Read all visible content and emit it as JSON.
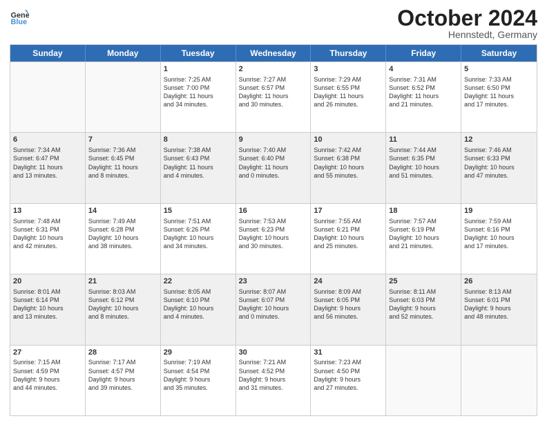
{
  "header": {
    "logo_line1": "General",
    "logo_line2": "Blue",
    "month": "October 2024",
    "location": "Hennstedt, Germany"
  },
  "weekdays": [
    "Sunday",
    "Monday",
    "Tuesday",
    "Wednesday",
    "Thursday",
    "Friday",
    "Saturday"
  ],
  "rows": [
    [
      {
        "day": "",
        "empty": true
      },
      {
        "day": "",
        "empty": true
      },
      {
        "day": "1",
        "lines": [
          "Sunrise: 7:25 AM",
          "Sunset: 7:00 PM",
          "Daylight: 11 hours",
          "and 34 minutes."
        ]
      },
      {
        "day": "2",
        "lines": [
          "Sunrise: 7:27 AM",
          "Sunset: 6:57 PM",
          "Daylight: 11 hours",
          "and 30 minutes."
        ]
      },
      {
        "day": "3",
        "lines": [
          "Sunrise: 7:29 AM",
          "Sunset: 6:55 PM",
          "Daylight: 11 hours",
          "and 26 minutes."
        ]
      },
      {
        "day": "4",
        "lines": [
          "Sunrise: 7:31 AM",
          "Sunset: 6:52 PM",
          "Daylight: 11 hours",
          "and 21 minutes."
        ]
      },
      {
        "day": "5",
        "lines": [
          "Sunrise: 7:33 AM",
          "Sunset: 6:50 PM",
          "Daylight: 11 hours",
          "and 17 minutes."
        ]
      }
    ],
    [
      {
        "day": "6",
        "lines": [
          "Sunrise: 7:34 AM",
          "Sunset: 6:47 PM",
          "Daylight: 11 hours",
          "and 13 minutes."
        ]
      },
      {
        "day": "7",
        "lines": [
          "Sunrise: 7:36 AM",
          "Sunset: 6:45 PM",
          "Daylight: 11 hours",
          "and 8 minutes."
        ]
      },
      {
        "day": "8",
        "lines": [
          "Sunrise: 7:38 AM",
          "Sunset: 6:43 PM",
          "Daylight: 11 hours",
          "and 4 minutes."
        ]
      },
      {
        "day": "9",
        "lines": [
          "Sunrise: 7:40 AM",
          "Sunset: 6:40 PM",
          "Daylight: 11 hours",
          "and 0 minutes."
        ]
      },
      {
        "day": "10",
        "lines": [
          "Sunrise: 7:42 AM",
          "Sunset: 6:38 PM",
          "Daylight: 10 hours",
          "and 55 minutes."
        ]
      },
      {
        "day": "11",
        "lines": [
          "Sunrise: 7:44 AM",
          "Sunset: 6:35 PM",
          "Daylight: 10 hours",
          "and 51 minutes."
        ]
      },
      {
        "day": "12",
        "lines": [
          "Sunrise: 7:46 AM",
          "Sunset: 6:33 PM",
          "Daylight: 10 hours",
          "and 47 minutes."
        ]
      }
    ],
    [
      {
        "day": "13",
        "lines": [
          "Sunrise: 7:48 AM",
          "Sunset: 6:31 PM",
          "Daylight: 10 hours",
          "and 42 minutes."
        ]
      },
      {
        "day": "14",
        "lines": [
          "Sunrise: 7:49 AM",
          "Sunset: 6:28 PM",
          "Daylight: 10 hours",
          "and 38 minutes."
        ]
      },
      {
        "day": "15",
        "lines": [
          "Sunrise: 7:51 AM",
          "Sunset: 6:26 PM",
          "Daylight: 10 hours",
          "and 34 minutes."
        ]
      },
      {
        "day": "16",
        "lines": [
          "Sunrise: 7:53 AM",
          "Sunset: 6:23 PM",
          "Daylight: 10 hours",
          "and 30 minutes."
        ]
      },
      {
        "day": "17",
        "lines": [
          "Sunrise: 7:55 AM",
          "Sunset: 6:21 PM",
          "Daylight: 10 hours",
          "and 25 minutes."
        ]
      },
      {
        "day": "18",
        "lines": [
          "Sunrise: 7:57 AM",
          "Sunset: 6:19 PM",
          "Daylight: 10 hours",
          "and 21 minutes."
        ]
      },
      {
        "day": "19",
        "lines": [
          "Sunrise: 7:59 AM",
          "Sunset: 6:16 PM",
          "Daylight: 10 hours",
          "and 17 minutes."
        ]
      }
    ],
    [
      {
        "day": "20",
        "lines": [
          "Sunrise: 8:01 AM",
          "Sunset: 6:14 PM",
          "Daylight: 10 hours",
          "and 13 minutes."
        ]
      },
      {
        "day": "21",
        "lines": [
          "Sunrise: 8:03 AM",
          "Sunset: 6:12 PM",
          "Daylight: 10 hours",
          "and 8 minutes."
        ]
      },
      {
        "day": "22",
        "lines": [
          "Sunrise: 8:05 AM",
          "Sunset: 6:10 PM",
          "Daylight: 10 hours",
          "and 4 minutes."
        ]
      },
      {
        "day": "23",
        "lines": [
          "Sunrise: 8:07 AM",
          "Sunset: 6:07 PM",
          "Daylight: 10 hours",
          "and 0 minutes."
        ]
      },
      {
        "day": "24",
        "lines": [
          "Sunrise: 8:09 AM",
          "Sunset: 6:05 PM",
          "Daylight: 9 hours",
          "and 56 minutes."
        ]
      },
      {
        "day": "25",
        "lines": [
          "Sunrise: 8:11 AM",
          "Sunset: 6:03 PM",
          "Daylight: 9 hours",
          "and 52 minutes."
        ]
      },
      {
        "day": "26",
        "lines": [
          "Sunrise: 8:13 AM",
          "Sunset: 6:01 PM",
          "Daylight: 9 hours",
          "and 48 minutes."
        ]
      }
    ],
    [
      {
        "day": "27",
        "lines": [
          "Sunrise: 7:15 AM",
          "Sunset: 4:59 PM",
          "Daylight: 9 hours",
          "and 44 minutes."
        ]
      },
      {
        "day": "28",
        "lines": [
          "Sunrise: 7:17 AM",
          "Sunset: 4:57 PM",
          "Daylight: 9 hours",
          "and 39 minutes."
        ]
      },
      {
        "day": "29",
        "lines": [
          "Sunrise: 7:19 AM",
          "Sunset: 4:54 PM",
          "Daylight: 9 hours",
          "and 35 minutes."
        ]
      },
      {
        "day": "30",
        "lines": [
          "Sunrise: 7:21 AM",
          "Sunset: 4:52 PM",
          "Daylight: 9 hours",
          "and 31 minutes."
        ]
      },
      {
        "day": "31",
        "lines": [
          "Sunrise: 7:23 AM",
          "Sunset: 4:50 PM",
          "Daylight: 9 hours",
          "and 27 minutes."
        ]
      },
      {
        "day": "",
        "empty": true
      },
      {
        "day": "",
        "empty": true
      }
    ]
  ]
}
